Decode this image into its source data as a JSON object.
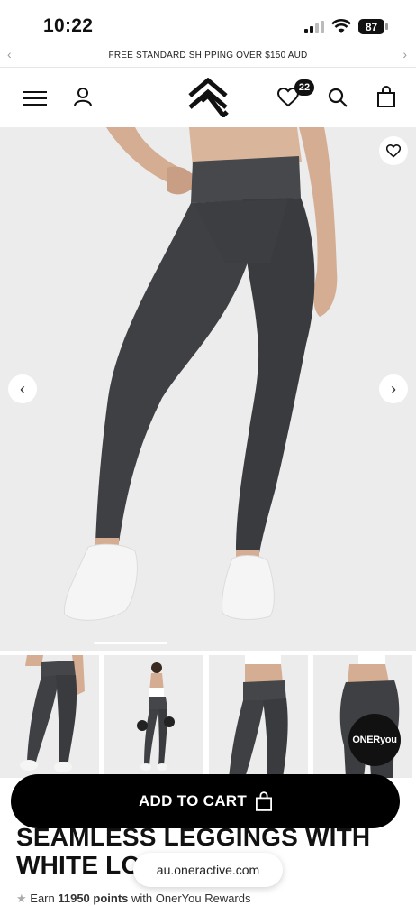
{
  "status_bar": {
    "time": "10:22",
    "battery": "87"
  },
  "promo": {
    "text": "FREE STANDARD SHIPPING OVER $150 AUD",
    "prev": "‹",
    "next": "›"
  },
  "header": {
    "wishlist_count": "22"
  },
  "hero": {
    "prev": "‹",
    "next": "›"
  },
  "badge": {
    "brand": "ONERyou"
  },
  "product": {
    "title": "SEAMLESS LEGGINGS WITH WHITE LO"
  },
  "cart": {
    "label": "ADD TO CART"
  },
  "browser": {
    "url": "au.oneractive.com"
  },
  "rewards": {
    "prefix": "Earn ",
    "points": "11950 points",
    "suffix": " with OnerYou Rewards"
  },
  "colors": {
    "legging": "#3e4043",
    "bg_hero": "#ececec",
    "cart_button": "#000000"
  }
}
